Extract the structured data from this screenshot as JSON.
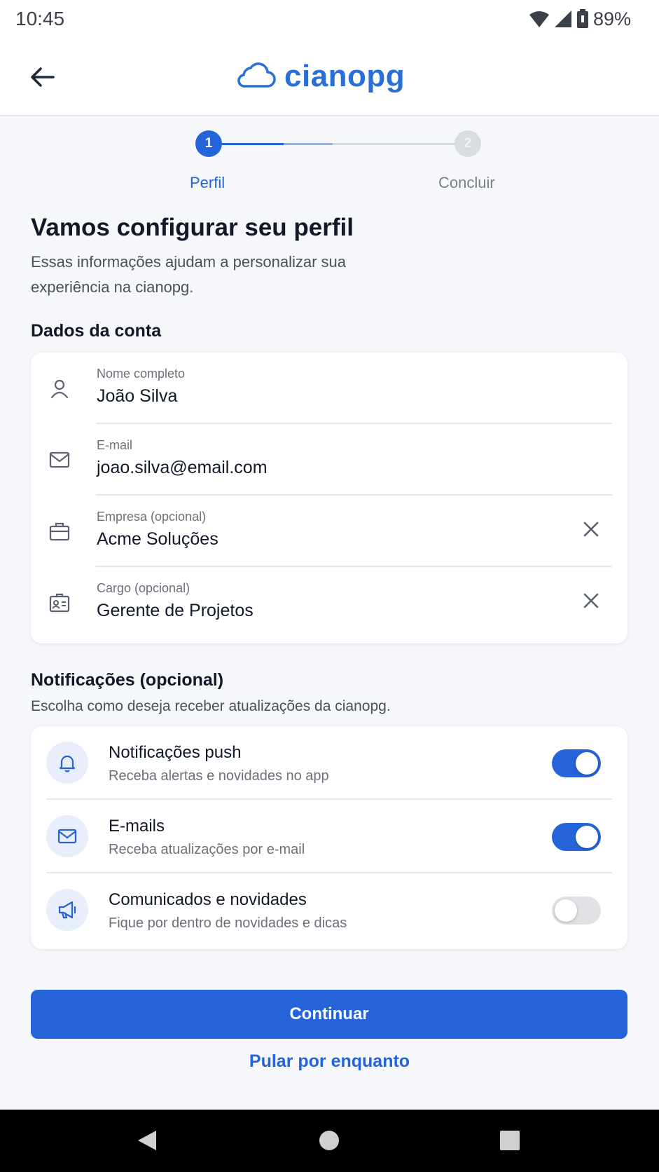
{
  "status_bar": {
    "time": "10:45",
    "battery": "89%",
    "icons": [
      "wifi-icon",
      "cellular-signal-icon",
      "battery-icon"
    ]
  },
  "header": {
    "app_name": "cianopg",
    "back_icon": "arrow-left-icon",
    "logo_icon": "cloud-icon",
    "brand_color": "#2a6fd8"
  },
  "stepper": {
    "steps": [
      {
        "number": "1",
        "label": "Perfil",
        "state": "active"
      },
      {
        "number": "2",
        "label": "Concluir",
        "state": "inactive"
      }
    ],
    "progress_fraction": 0.35
  },
  "intro": {
    "title": "Vamos configurar seu perfil",
    "subtitle": "Essas informações ajudam a personalizar sua experiência na cianopg."
  },
  "account": {
    "section_title": "Dados da conta",
    "fields": [
      {
        "label": "Nome completo",
        "value": "João Silva",
        "icon": "user-icon",
        "clearable": false
      },
      {
        "label": "E-mail",
        "value": "joao.silva@email.com",
        "icon": "mail-icon",
        "clearable": false
      },
      {
        "label": "Empresa (opcional)",
        "value": "Acme Soluções",
        "icon": "briefcase-icon",
        "clearable": true
      },
      {
        "label": "Cargo (opcional)",
        "value": "Gerente de Projetos",
        "icon": "id-card-icon",
        "clearable": true
      }
    ]
  },
  "notifications": {
    "section_title": "Notificações (opcional)",
    "section_subtitle": "Escolha como deseja receber atualizações da cianopg.",
    "items": [
      {
        "title": "Notificações push",
        "subtitle": "Receba alertas e novidades no app",
        "icon": "bell-icon",
        "enabled": true
      },
      {
        "title": "E-mails",
        "subtitle": "Receba atualizações por e-mail",
        "icon": "mail-icon",
        "enabled": true
      },
      {
        "title": "Comunicados e novidades",
        "subtitle": "Fique por dentro de novidades e dicas",
        "icon": "megaphone-icon",
        "enabled": false
      }
    ]
  },
  "actions": {
    "primary_label": "Continuar",
    "secondary_label": "Pular por enquanto",
    "accent_color": "#2563d8"
  },
  "system_nav": {
    "icons": [
      "back-triangle-icon",
      "home-circle-icon",
      "recents-square-icon"
    ]
  }
}
